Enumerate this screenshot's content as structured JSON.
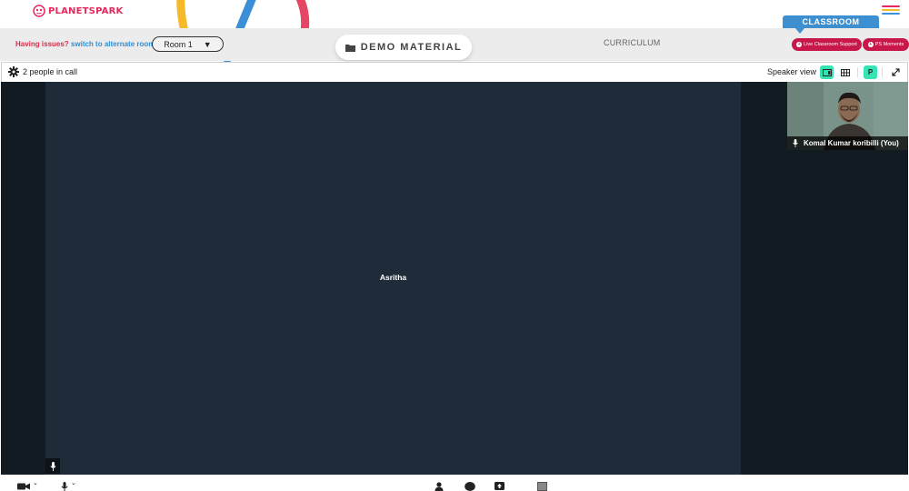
{
  "brand": {
    "name": "PLANETSPARK"
  },
  "colors": {
    "brand_pink": "#e7285e",
    "link_blue": "#2f8fd6",
    "issue_red": "#d92d4c",
    "classroom_blue": "#3d8fd0",
    "pill_red": "#c8174a",
    "active_green": "#35e3b4",
    "stage_dark": "#121a22",
    "tile_dark": "#202b39"
  },
  "header": {
    "issue_question": "Having issues?",
    "issue_link": "switch to alternate room",
    "room_select": {
      "value": "Room 1"
    },
    "demo_button": "DEMO MATERIAL",
    "curriculum_tab": "CURRICULUM",
    "classroom_tab": "CLASSROOM",
    "live_support": "Live Classroom Support",
    "ps_moments": "PS Moments"
  },
  "call": {
    "people_count": "2 people in call",
    "view_label": "Speaker view",
    "participant_initial": "P"
  },
  "participants": {
    "main": {
      "name": "Asritha"
    },
    "self": {
      "name": "Komal Kumar koribilli (You)"
    }
  },
  "icons": {
    "header": [
      "logo-icon",
      "hamburger-menu-icon",
      "folder-icon"
    ],
    "callbar": [
      "gear-icon",
      "speaker-view-icon",
      "grid-view-icon",
      "expand-icon"
    ],
    "stage": [
      "microphone-icon"
    ],
    "bottombar": [
      "camera-icon",
      "chevron-down-icon",
      "microphone-icon",
      "person-icon",
      "chat-bubble-icon",
      "share-screen-icon",
      "whiteboard-icon"
    ]
  }
}
